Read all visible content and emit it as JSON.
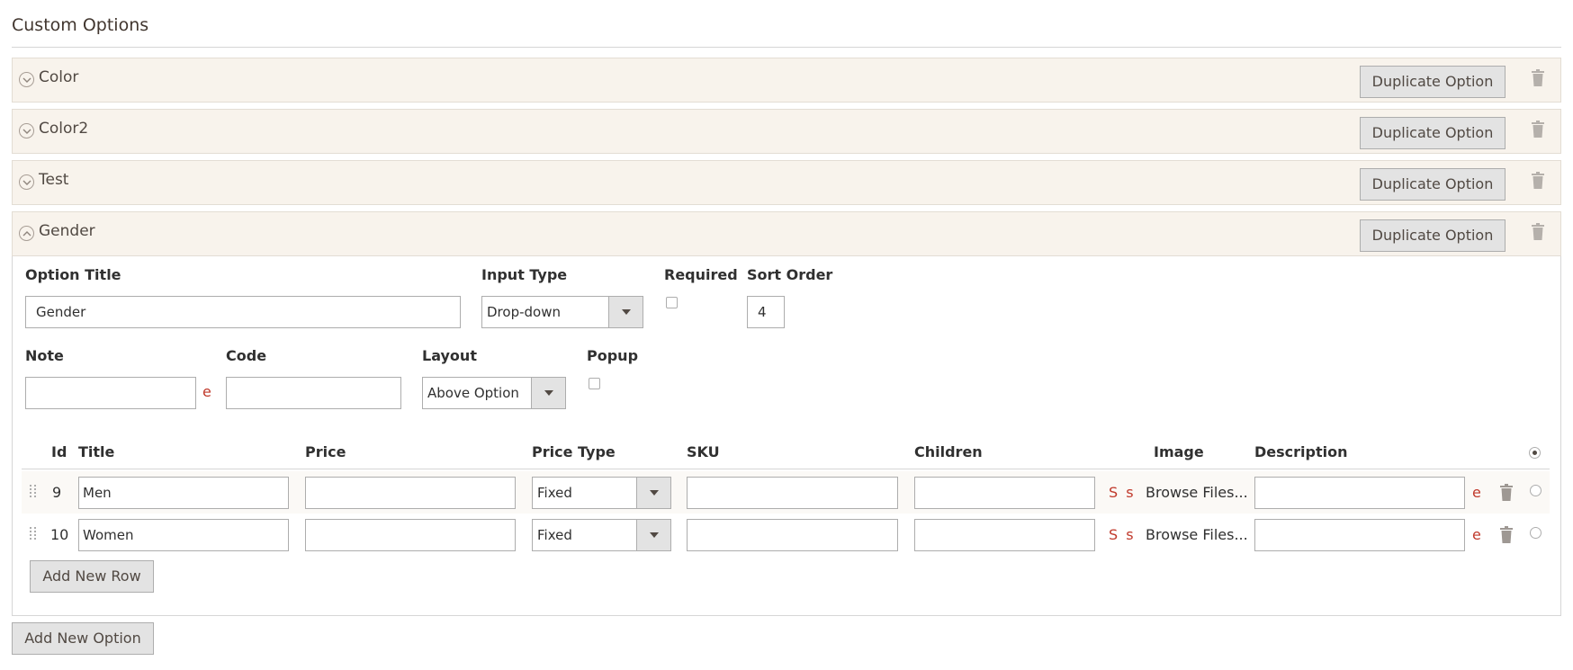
{
  "section": {
    "title": "Custom Options"
  },
  "options": [
    {
      "name": "Color",
      "duplicate_label": "Duplicate Option"
    },
    {
      "name": "Color2",
      "duplicate_label": "Duplicate Option"
    },
    {
      "name": "Test",
      "duplicate_label": "Duplicate Option"
    },
    {
      "name": "Gender",
      "duplicate_label": "Duplicate Option"
    }
  ],
  "form": {
    "option_title_label": "Option Title",
    "option_title_value": "Gender",
    "input_type_label": "Input Type",
    "input_type_value": "Drop-down",
    "required_label": "Required",
    "required_checked": false,
    "sort_order_label": "Sort Order",
    "sort_order_value": "4",
    "note_label": "Note",
    "note_value": "",
    "note_editor_mark": "e",
    "code_label": "Code",
    "code_value": "",
    "layout_label": "Layout",
    "layout_value": "Above Option",
    "popup_label": "Popup",
    "popup_checked": false
  },
  "grid": {
    "headers": {
      "id": "Id",
      "title": "Title",
      "price": "Price",
      "price_type": "Price Type",
      "sku": "SKU",
      "children": "Children",
      "image": "Image",
      "description": "Description"
    },
    "rows": [
      {
        "id": "9",
        "title": "Men",
        "price": "",
        "price_type": "Fixed",
        "sku": "",
        "children": "",
        "image_marks": "S s",
        "browse_label": "Browse Files...",
        "description": "",
        "editor_mark": "e",
        "default_selected": false
      },
      {
        "id": "10",
        "title": "Women",
        "price": "",
        "price_type": "Fixed",
        "sku": "",
        "children": "",
        "image_marks": "S s",
        "browse_label": "Browse Files...",
        "description": "",
        "editor_mark": "e",
        "default_selected": false
      }
    ],
    "header_default_selected": true,
    "add_row_label": "Add New Row"
  },
  "footer": {
    "add_option_label": "Add New Option"
  },
  "icons": {
    "toggle_collapsed": "chevron-down-circle-icon",
    "toggle_expanded": "chevron-up-circle-icon",
    "delete": "trash-icon",
    "drag": "drag-handle-icon",
    "dropdown": "caret-down-icon"
  },
  "colors": {
    "header_bg": "#f8f3ec",
    "accent_red": "#c0392b",
    "button_bg": "#e3e3e3",
    "text": "#303030"
  }
}
